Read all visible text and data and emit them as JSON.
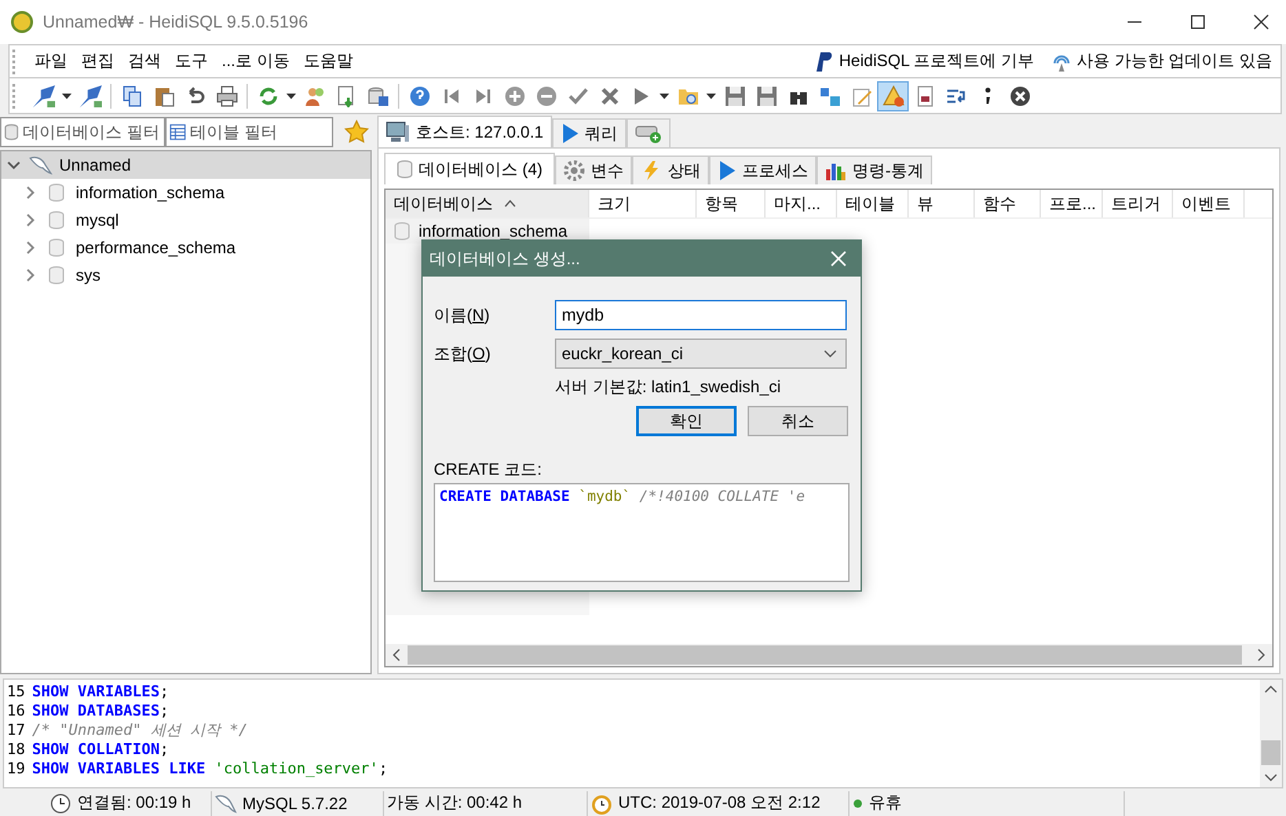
{
  "window": {
    "title": "Unnamed₩ - HeidiSQL 9.5.0.5196"
  },
  "menu": [
    "파일",
    "편집",
    "검색",
    "도구",
    "...로 이동",
    "도움말"
  ],
  "menu_links": [
    {
      "kind": "donate",
      "label": "HeidiSQL 프로젝트에 기부"
    },
    {
      "kind": "update",
      "label": "사용 가능한 업데이트 있음"
    }
  ],
  "toolbar": [
    {
      "kind": "connect"
    },
    {
      "kind": "caret"
    },
    {
      "kind": "disconnect"
    },
    {
      "kind": "sep"
    },
    {
      "kind": "copy"
    },
    {
      "kind": "paste"
    },
    {
      "kind": "undo"
    },
    {
      "kind": "print"
    },
    {
      "kind": "sep"
    },
    {
      "kind": "refresh"
    },
    {
      "kind": "caret"
    },
    {
      "kind": "user"
    },
    {
      "kind": "export"
    },
    {
      "kind": "import"
    },
    {
      "kind": "sep"
    },
    {
      "kind": "help"
    },
    {
      "kind": "first"
    },
    {
      "kind": "last"
    },
    {
      "kind": "plus"
    },
    {
      "kind": "minus"
    },
    {
      "kind": "check"
    },
    {
      "kind": "cross"
    },
    {
      "kind": "play"
    },
    {
      "kind": "caret"
    },
    {
      "kind": "folder"
    },
    {
      "kind": "caret"
    },
    {
      "kind": "save"
    },
    {
      "kind": "saveas"
    },
    {
      "kind": "binoculars"
    },
    {
      "kind": "replace"
    },
    {
      "kind": "pencil"
    },
    {
      "kind": "warning",
      "pressed": true
    },
    {
      "kind": "hexdoc"
    },
    {
      "kind": "wrap"
    },
    {
      "kind": "semicolon"
    },
    {
      "kind": "stop"
    }
  ],
  "filters": {
    "database": {
      "placeholder": "데이터베이스 필터"
    },
    "table": {
      "placeholder": "테이블 필터"
    }
  },
  "tree": [
    {
      "label": "Unnamed",
      "expanded": true,
      "selected": true,
      "children": [
        {
          "label": "information_schema",
          "expanded": false,
          "selected": false
        },
        {
          "label": "mysql",
          "expanded": false,
          "selected": false
        },
        {
          "label": "performance_schema",
          "expanded": false,
          "selected": false
        },
        {
          "label": "sys",
          "expanded": false,
          "selected": false
        }
      ]
    }
  ],
  "tabs": [
    {
      "kind": "host",
      "label": "호스트: 127.0.0.1",
      "selected": true
    },
    {
      "kind": "query",
      "label": "쿼리",
      "selected": false
    },
    {
      "kind": "new",
      "selected": false
    }
  ],
  "subtabs": [
    {
      "kind": "database",
      "label": "데이터베이스 (4)",
      "selected": true
    },
    {
      "kind": "variables",
      "label": "변수",
      "selected": false
    },
    {
      "kind": "status",
      "label": "상태",
      "selected": false
    },
    {
      "kind": "process",
      "label": "프로세스",
      "selected": false
    },
    {
      "kind": "stats",
      "label": "명령-통계",
      "selected": false
    }
  ],
  "grid": {
    "columns": [
      {
        "label": "데이터베이스",
        "sorted": true
      },
      {
        "label": "크기",
        "sorted": false
      },
      {
        "label": "항목",
        "sorted": false
      },
      {
        "label": "마지...",
        "sorted": false
      },
      {
        "label": "테이블",
        "sorted": false
      },
      {
        "label": "뷰",
        "sorted": false
      },
      {
        "label": "함수",
        "sorted": false
      },
      {
        "label": "프로...",
        "sorted": false
      },
      {
        "label": "트리거",
        "sorted": false
      },
      {
        "label": "이벤트",
        "sorted": false
      }
    ],
    "rows": [
      "information_schema"
    ]
  },
  "dialog": {
    "title": "데이터베이스 생성...",
    "name_label": [
      "이름(",
      "N",
      ")"
    ],
    "name_value": "mydb",
    "collation_label": [
      "조합(",
      "O",
      ")"
    ],
    "collation_value": "euckr_korean_ci",
    "server_default": "서버 기본값: latin1_swedish_ci",
    "buttons": [
      {
        "label": "확인",
        "selected": true
      },
      {
        "label": "취소",
        "selected": false
      }
    ],
    "code_label": "CREATE 코드:",
    "code": [
      {
        "kind": "keyword",
        "text": "CREATE DATABASE"
      },
      {
        "kind": "ident",
        "text": " `mydb`"
      },
      {
        "kind": "comment",
        "text": " /*!40100 COLLATE 'e"
      }
    ]
  },
  "log": [
    {
      "num": "15",
      "parts": [
        {
          "kind": "keyword",
          "text": "SHOW VARIABLES"
        },
        {
          "kind": "plain",
          "text": ";"
        }
      ]
    },
    {
      "num": "16",
      "parts": [
        {
          "kind": "keyword",
          "text": "SHOW DATABASES"
        },
        {
          "kind": "plain",
          "text": ";"
        }
      ]
    },
    {
      "num": "17",
      "parts": [
        {
          "kind": "comment",
          "text": "/* \"Unnamed\" 세션 시작 */"
        }
      ]
    },
    {
      "num": "18",
      "parts": [
        {
          "kind": "keyword",
          "text": "SHOW COLLATION"
        },
        {
          "kind": "plain",
          "text": ";"
        }
      ]
    },
    {
      "num": "19",
      "parts": [
        {
          "kind": "keyword",
          "text": "SHOW VARIABLES LIKE"
        },
        {
          "kind": "string",
          "text": " 'collation_server'"
        },
        {
          "kind": "plain",
          "text": ";"
        }
      ]
    }
  ],
  "status_bar": [
    {
      "kind": "clock",
      "text": "연결됨: 00:19 h"
    },
    {
      "kind": "server",
      "text": "MySQL 5.7.22"
    },
    {
      "kind": "plain",
      "text": "가동 시간: 00:42 h"
    },
    {
      "kind": "alarm",
      "text": "UTC: 2019-07-08 오전 2:12"
    },
    {
      "kind": "idle",
      "text": "유휴"
    }
  ]
}
